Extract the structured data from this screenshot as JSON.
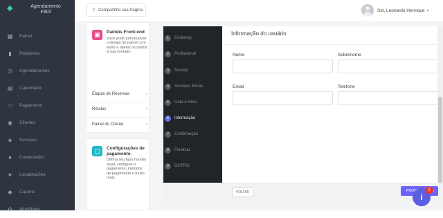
{
  "app": {
    "brand_line1": "Agendamento",
    "brand_line2": "Fácil"
  },
  "sidebar": {
    "items": [
      {
        "label": "Painel",
        "icon": "dashboard-icon"
      },
      {
        "label": "Relatórios",
        "icon": "chart-icon"
      },
      {
        "label": "Agendamentos",
        "icon": "calendar-icon"
      },
      {
        "label": "Calendário",
        "icon": "calendar-grid-icon"
      },
      {
        "label": "Pagamento",
        "icon": "payment-icon"
      },
      {
        "label": "Clientes",
        "icon": "customers-icon"
      },
      {
        "label": "Serviços",
        "icon": "services-icon"
      },
      {
        "label": "Colaborador",
        "icon": "employee-icon"
      },
      {
        "label": "Localizações",
        "icon": "location-icon"
      },
      {
        "label": "Cupons",
        "icon": "coupon-icon"
      },
      {
        "label": "Workflows",
        "icon": "workflow-icon"
      }
    ]
  },
  "header": {
    "share_label": "Compartilhe sua Página",
    "user_name": "Sid, Leonardo Henrique"
  },
  "cards": {
    "frontend": {
      "title": "Painéis Front-end",
      "desc": "Você pode personalizar o design do painel com estilo e alterar os dados à sua vontade.",
      "links": [
        "Etapas de Reservas",
        "Rótulos",
        "Painel do Cliente"
      ]
    },
    "payment": {
      "title": "Configurações de pagamento",
      "desc": "Defina seu fuso horário atual, configure o pagamento, métodos de pagamento e muito mais."
    }
  },
  "steps": [
    {
      "num": "1",
      "label": "Endereço"
    },
    {
      "num": "2",
      "label": "Profissional"
    },
    {
      "num": "3",
      "label": "Serviço"
    },
    {
      "num": "4",
      "label": "Serviços Extras"
    },
    {
      "num": "5",
      "label": "Data e Hora"
    },
    {
      "num": "6",
      "label": "Informação"
    },
    {
      "num": "7",
      "label": "Confirmação"
    },
    {
      "num": "8",
      "label": "Finalizar"
    },
    {
      "num": "9",
      "label": "OUTRO"
    }
  ],
  "form": {
    "title": "Informação do usuário",
    "fields": {
      "name": "Nome",
      "surname": "Sobrenome",
      "email": "Email",
      "phone": "Telefone"
    }
  },
  "footer": {
    "back_label": "VOLTAR",
    "next_label": "PRÓXIMA ETAPA"
  },
  "chat": {
    "badge": "2",
    "icon": "info-icon"
  },
  "colors": {
    "sidebar_bg": "#2f3441",
    "accent": "#6c63ff",
    "brand": "#38c9b3",
    "active_step": "#5b6ee1",
    "pink": "#e84c8b",
    "teal": "#22b8c7"
  }
}
